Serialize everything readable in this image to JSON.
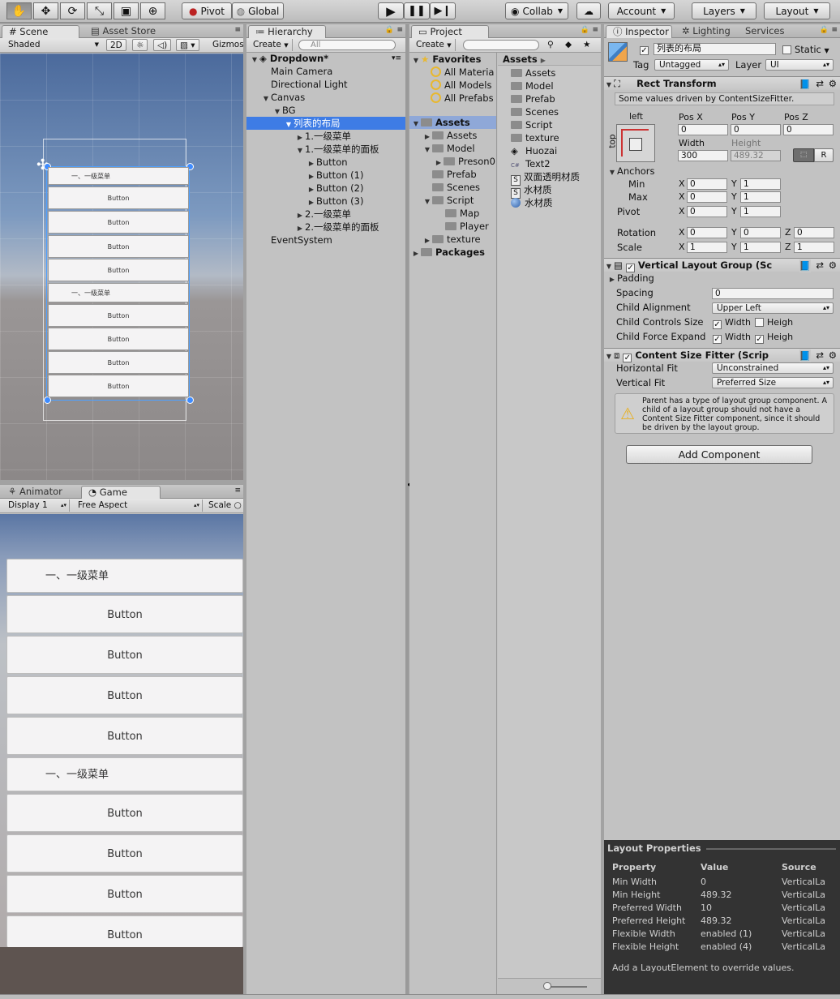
{
  "toolbar": {
    "tools": [
      "hand-icon",
      "move-icon",
      "rotate-icon",
      "scale-icon",
      "rect-icon",
      "transform-icon"
    ],
    "pivot": "Pivot",
    "global": "Global",
    "collab": "Collab",
    "account": "Account",
    "layers": "Layers",
    "layout": "Layout"
  },
  "scene": {
    "tabs": [
      "Scene",
      "Asset Store"
    ],
    "shading": "Shaded",
    "mode2d": "2D",
    "gizmos": "Gizmos",
    "menu_label": "一、一级菜单",
    "button_label": "Button"
  },
  "game": {
    "tabs": [
      "Animator",
      "Game"
    ],
    "display": "Display 1",
    "aspect": "Free Aspect",
    "scale": "Scale",
    "menu_label": "一、一级菜单",
    "button_label": "Button"
  },
  "hierarchy": {
    "tab": "Hierarchy",
    "create": "Create",
    "search_placeholder": "All",
    "scene_name": "Dropdown*",
    "rows": [
      {
        "label": "Main Camera"
      },
      {
        "label": "Directional Light"
      },
      {
        "label": "Canvas"
      },
      {
        "label": "BG"
      },
      {
        "label": "列表的布局"
      },
      {
        "label": "1.一级菜单"
      },
      {
        "label": "1.一级菜单的面板"
      },
      {
        "label": "Button"
      },
      {
        "label": "Button (1)"
      },
      {
        "label": "Button (2)"
      },
      {
        "label": "Button (3)"
      },
      {
        "label": "2.一级菜单"
      },
      {
        "label": "2.一级菜单的面板"
      },
      {
        "label": "EventSystem"
      }
    ]
  },
  "project": {
    "tab": "Project",
    "create": "Create",
    "favorites": "Favorites",
    "fav_items": [
      "All Materia",
      "All Models",
      "All Prefabs"
    ],
    "tree": [
      "Assets",
      "Assets",
      "Model",
      "Preson0",
      "Prefab",
      "Scenes",
      "Script",
      "Map",
      "Player",
      "texture",
      "Packages"
    ],
    "breadcrumb": "Assets",
    "files": [
      "Assets",
      "Model",
      "Prefab",
      "Scenes",
      "Script",
      "texture",
      "Huozai",
      "Text2",
      "双面透明材质",
      "水材质",
      "水材质"
    ]
  },
  "inspector": {
    "tabs": [
      "Inspector",
      "Lighting",
      "Services"
    ],
    "object_name": "列表的布局",
    "static": "Static",
    "tag_label": "Tag",
    "tag": "Untagged",
    "layer_label": "Layer",
    "layer": "UI",
    "rect": {
      "title": "Rect Transform",
      "notice": "Some values driven by ContentSizeFitter.",
      "anchor_h": "left",
      "anchor_v": "top",
      "posx_label": "Pos X",
      "posy_label": "Pos Y",
      "posz_label": "Pos Z",
      "posx": "0",
      "posy": "0",
      "posz": "0",
      "width_label": "Width",
      "height_label": "Height",
      "width": "300",
      "height": "489.32",
      "r_btn": "R",
      "anchors": "Anchors",
      "min": "Min",
      "max": "Max",
      "pivot": "Pivot",
      "min_x": "0",
      "min_y": "1",
      "max_x": "0",
      "max_y": "1",
      "pivot_x": "0",
      "pivot_y": "1",
      "rotation": "Rotation",
      "scale": "Scale",
      "rot_x": "0",
      "rot_y": "0",
      "rot_z": "0",
      "scale_x": "1",
      "scale_y": "1",
      "scale_z": "1",
      "x": "X",
      "y": "Y",
      "z": "Z"
    },
    "vlg": {
      "title": "Vertical Layout Group (Sc",
      "padding": "Padding",
      "spacing_label": "Spacing",
      "spacing": "0",
      "align_label": "Child Alignment",
      "align": "Upper Left",
      "controls_label": "Child Controls Size",
      "expand_label": "Child Force Expand",
      "width": "Width",
      "height": "Heigh"
    },
    "csf": {
      "title": "Content Size Fitter (Scrip",
      "hfit_label": "Horizontal Fit",
      "hfit": "Unconstrained",
      "vfit_label": "Vertical Fit",
      "vfit": "Preferred Size",
      "warning": "Parent has a type of layout group component. A child of a layout group should not have a Content Size Fitter component, since it should be driven by the layout group."
    },
    "add_component": "Add Component"
  },
  "layout_props": {
    "title": "Layout Properties",
    "headers": [
      "Property",
      "Value",
      "Source"
    ],
    "rows": [
      [
        "Min Width",
        "0",
        "VerticalLa"
      ],
      [
        "Min Height",
        "489.32",
        "VerticalLa"
      ],
      [
        "Preferred Width",
        "10",
        "VerticalLa"
      ],
      [
        "Preferred Height",
        "489.32",
        "VerticalLa"
      ],
      [
        "Flexible Width",
        "enabled (1)",
        "VerticalLa"
      ],
      [
        "Flexible Height",
        "enabled (4)",
        "VerticalLa"
      ]
    ],
    "footer": "Add a LayoutElement to override values."
  }
}
